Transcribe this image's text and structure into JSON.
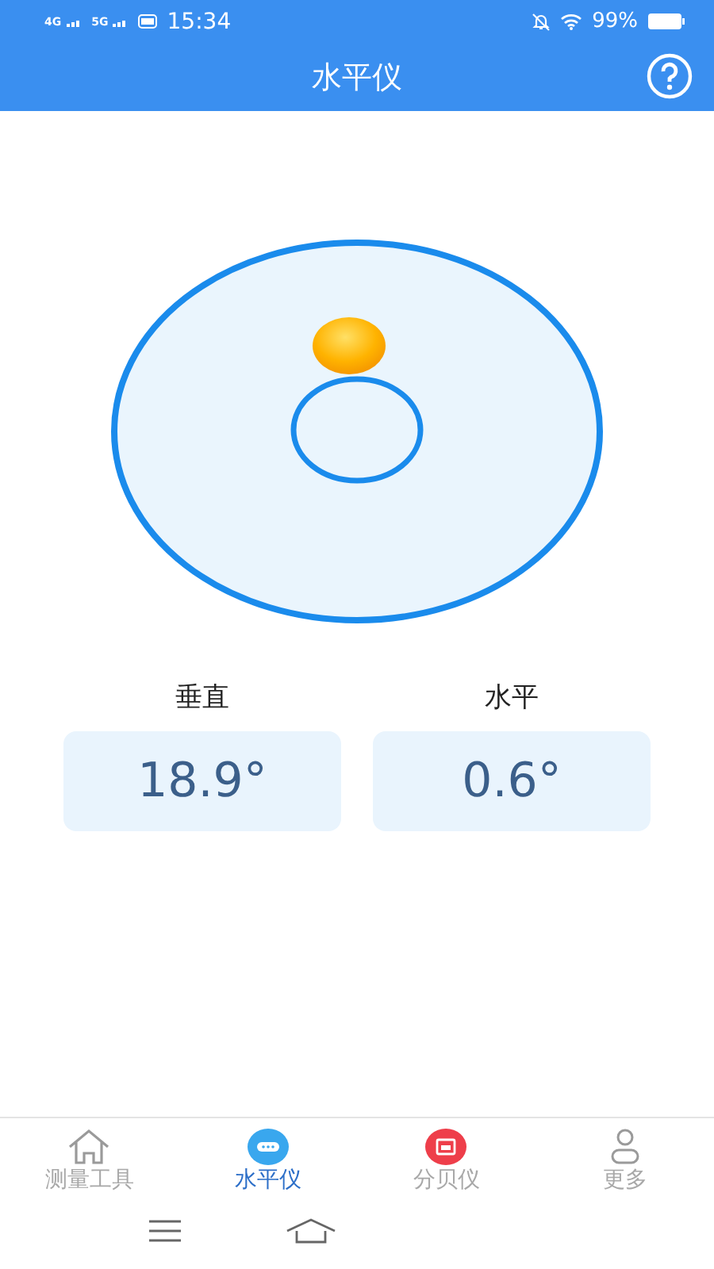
{
  "status_bar": {
    "signal_1": "4G",
    "signal_2": "5G",
    "time": "15:34",
    "battery": "99%"
  },
  "header": {
    "title": "水平仪"
  },
  "readings": [
    {
      "label": "垂直",
      "value": "18.9°"
    },
    {
      "label": "水平",
      "value": "0.6°"
    }
  ],
  "tabs": [
    {
      "label": "测量工具",
      "kind": "home",
      "selected": false
    },
    {
      "label": "水平仪",
      "kind": "level",
      "selected": true
    },
    {
      "label": "分贝仪",
      "kind": "decibel",
      "selected": false
    },
    {
      "label": "更多",
      "kind": "user",
      "selected": false
    }
  ]
}
